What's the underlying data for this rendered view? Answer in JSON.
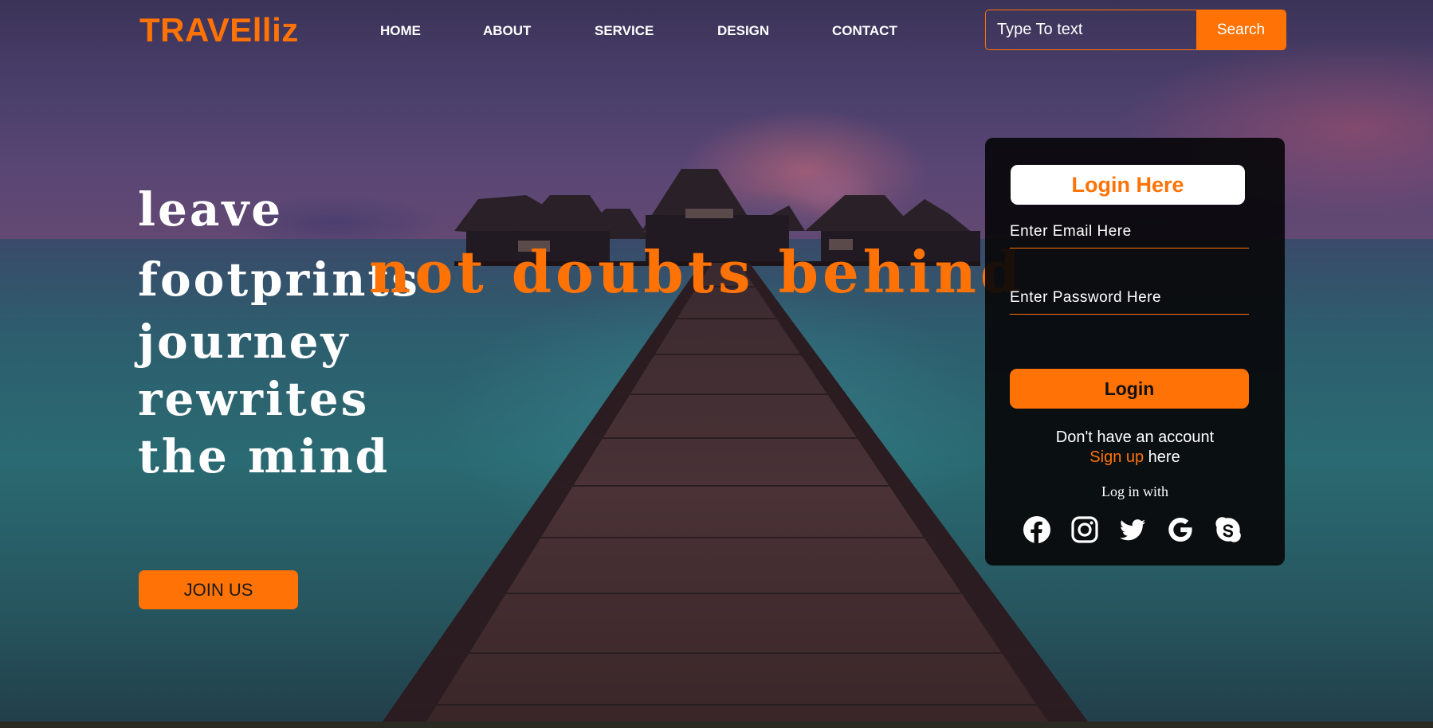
{
  "header": {
    "logo": "TRAVElliz",
    "nav": [
      "HOME",
      "ABOUT",
      "SERVICE",
      "DESIGN",
      "CONTACT"
    ],
    "search": {
      "placeholder": "Type To text",
      "button_label": "Search"
    }
  },
  "hero": {
    "lines": [
      "leave",
      "footprints",
      "journey",
      "rewrites",
      "the mind"
    ],
    "accent": "not doubts behind",
    "cta_label": "JOIN US"
  },
  "login": {
    "title": "Login Here",
    "email_placeholder": "Enter Email Here",
    "password_placeholder": "Enter Password Here",
    "button_label": "Login",
    "no_account_text": "Don't have an account",
    "signup_link": "Sign up",
    "signup_suffix": " here",
    "log_in_with": "Log in with",
    "social": [
      "facebook-icon",
      "instagram-icon",
      "twitter-icon",
      "google-icon",
      "skype-icon"
    ]
  },
  "colors": {
    "accent": "#ff7205",
    "card": "#08080a",
    "text": "#ffffff"
  }
}
